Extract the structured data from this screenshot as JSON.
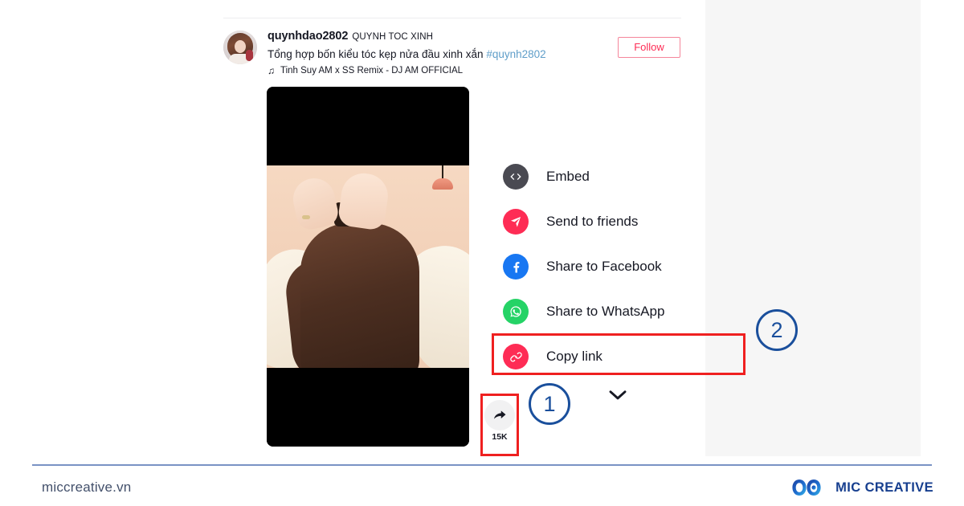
{
  "post": {
    "avatar_alt": "quynhdao2802 profile photo",
    "username": "quynhdao2802",
    "nickname": "QUYNH TOC XINH",
    "caption": "Tổng hợp bốn kiểu tóc kẹp nửa đầu xinh xắn ",
    "hashtag": "#quynh2802",
    "music_note": "♫",
    "music": "Tinh Suy AM x SS Remix - DJ AM OFFICIAL",
    "follow_label": "Follow"
  },
  "video": {
    "share_count": "15K"
  },
  "share_menu": {
    "items": [
      {
        "label": "Embed",
        "icon": "embed-icon",
        "glyph": "</>",
        "color": "#4a4a52"
      },
      {
        "label": "Send to friends",
        "icon": "send-icon",
        "glyph": "➤",
        "color": "#fe2c55"
      },
      {
        "label": "Share to Facebook",
        "icon": "facebook-icon",
        "glyph": "f",
        "color": "#1877f2"
      },
      {
        "label": "Share to WhatsApp",
        "icon": "whatsapp-icon",
        "glyph": "✆",
        "color": "#25d366"
      },
      {
        "label": "Copy link",
        "icon": "link-icon",
        "glyph": "🔗",
        "color": "#fe2c55"
      }
    ],
    "expand_glyph": "⌄"
  },
  "annotations": {
    "step_one": "1",
    "step_two": "2",
    "highlight_color": "#ef2020",
    "marker_color": "#1a4f9c"
  },
  "footer": {
    "url": "miccreative.vn",
    "brand": "MIC CREATIVE"
  }
}
